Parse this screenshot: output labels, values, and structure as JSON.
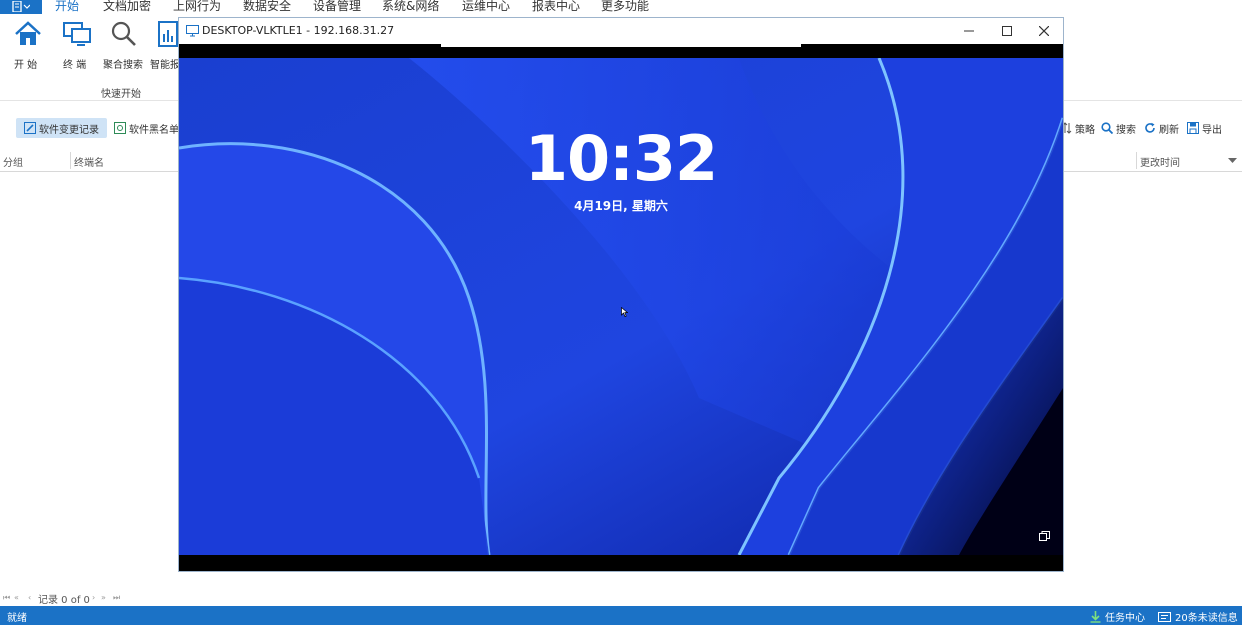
{
  "menu": {
    "tabs": [
      {
        "label": "开始",
        "active": true
      },
      {
        "label": "文档加密"
      },
      {
        "label": "上网行为"
      },
      {
        "label": "数据安全"
      },
      {
        "label": "设备管理"
      },
      {
        "label": "系统&网络"
      },
      {
        "label": "运维中心"
      },
      {
        "label": "报表中心"
      },
      {
        "label": "更多功能"
      }
    ]
  },
  "ribbon": {
    "buttons": [
      {
        "label": "开 始",
        "icon": "home-icon"
      },
      {
        "label": "终 端",
        "icon": "monitor-icon"
      },
      {
        "label": "聚合搜索",
        "icon": "search-icon"
      },
      {
        "label": "智能报",
        "icon": "report-icon"
      }
    ],
    "group_label": "快速开始"
  },
  "toolbar": {
    "left": [
      {
        "label": "软件变更记录",
        "active": true,
        "icon": "software-change-icon"
      },
      {
        "label": "软件黑名单",
        "icon": "software-blacklist-icon"
      }
    ],
    "right": [
      {
        "label": "策略",
        "icon": "sort-icon"
      },
      {
        "label": "搜索",
        "icon": "search-icon"
      },
      {
        "label": "刷新",
        "icon": "refresh-icon"
      },
      {
        "label": "导出",
        "icon": "export-icon"
      }
    ]
  },
  "grid": {
    "columns": [
      "分组",
      "终端名",
      "更改时间"
    ]
  },
  "pager": {
    "text": "记录 0 of 0"
  },
  "statusbar": {
    "left": "就绪",
    "task_center": "任务中心",
    "unread": "20条未读信息"
  },
  "remote": {
    "title": "DESKTOP-VLKTLE1 - 192.168.31.27",
    "clock": "10:32",
    "date": "4月19日, 星期六"
  },
  "colors": {
    "accent": "#1b72c6",
    "wallpaper_blue": "#1f3fd6"
  }
}
